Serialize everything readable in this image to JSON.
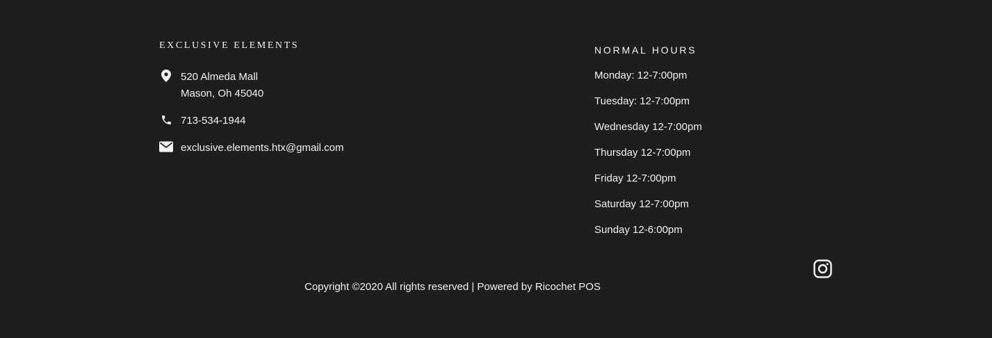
{
  "brand": {
    "title": "EXCLUSIVE ELEMENTS"
  },
  "contact": {
    "address_line1": "520 Almeda Mall",
    "address_line2": "Mason, Oh 45040",
    "phone": "713-534-1944",
    "email": "exclusive.elements.htx@gmail.com",
    "icons": {
      "address": "map-pin-icon",
      "phone": "phone-icon",
      "email": "envelope-icon"
    }
  },
  "hours": {
    "title": "NORMAL HOURS",
    "days": [
      "Monday: 12-7:00pm",
      "Tuesday: 12-7:00pm",
      "Wednesday 12-7:00pm",
      "Thursday 12-7:00pm",
      "Friday 12-7:00pm",
      "Saturday 12-7:00pm",
      "Sunday 12-6:00pm"
    ]
  },
  "social": {
    "instagram_icon": "instagram-icon"
  },
  "footer": {
    "copyright": "Copyright ©2020 All rights reserved | Powered by Ricochet POS"
  },
  "colors": {
    "background": "#1e1e1e",
    "text": "#f2f2f2"
  }
}
